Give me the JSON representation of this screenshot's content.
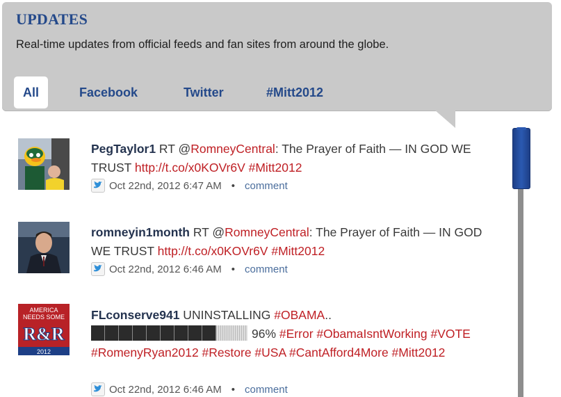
{
  "header": {
    "title": "UPDATES",
    "subtitle": "Real-time updates from official feeds and fan sites from around the globe."
  },
  "tabs": [
    {
      "label": "All",
      "active": true
    },
    {
      "label": "Facebook",
      "active": false
    },
    {
      "label": "Twitter",
      "active": false
    },
    {
      "label": "#Mitt2012",
      "active": false
    }
  ],
  "colors": {
    "accent_blue": "#24498a",
    "link_red": "#bf1f24",
    "header_bg": "#c9c9c9",
    "scroll_thumb": "#2b59b1"
  },
  "posts": [
    {
      "user": "PegTaylor1",
      "t1": " RT @",
      "mention": "RomneyCentral",
      "t2": ": The Prayer of Faith — IN GOD WE TRUST ",
      "link": "http://t.co/x0KOVr6V",
      "t3": " ",
      "hashtag": "#Mitt2012",
      "date": "Oct 22nd, 2012 6:47 AM",
      "separator": "•",
      "comment": "comment",
      "source_icon": "twitter-bird-icon"
    },
    {
      "user": "romneyin1month",
      "t1": " RT @",
      "mention": "RomneyCentral",
      "t2": ": The Prayer of Faith — IN GOD WE TRUST ",
      "link": "http://t.co/x0KOVr6V",
      "t3": " ",
      "hashtag": "#Mitt2012",
      "date": "Oct 22nd, 2012 6:46 AM",
      "separator": "•",
      "comment": "comment",
      "source_icon": "twitter-bird-icon"
    },
    {
      "user": "FLconserve941",
      "t1": " UNINSTALLING ",
      "hashtag1": "#OBAMA",
      "t2": "..",
      "progress_percent": 80,
      "percent_text": "96%",
      "hashtags_rest": "#Error #ObamaIsntWorking #VOTE #RomenyRyan2012 #Restore #USA #CantAfford4More #Mitt2012",
      "date": "Oct 22nd, 2012 6:46 AM",
      "separator": "•",
      "comment": "comment",
      "source_icon": "twitter-bird-icon",
      "avatar_text": {
        "line1": "AMERICA",
        "line2": "NEEDS SOME",
        "mark": "R&R",
        "year": "2012"
      }
    }
  ]
}
